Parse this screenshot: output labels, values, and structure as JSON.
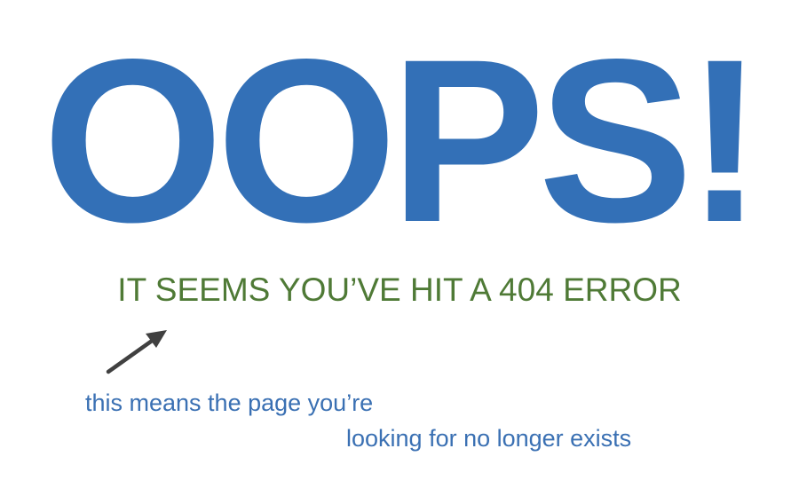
{
  "error_page": {
    "headline": "OOPS!",
    "subheadline": "IT SEEMS YOU’VE HIT A 404 ERROR",
    "explanation_line1": "this means the page you’re",
    "explanation_line2": "looking for no longer exists",
    "arrow_icon": "arrow-up-right-icon"
  },
  "colors": {
    "headline": "#3370b7",
    "subheadline": "#4f7a36",
    "explanation": "#3a70b3",
    "arrow": "#404040"
  }
}
